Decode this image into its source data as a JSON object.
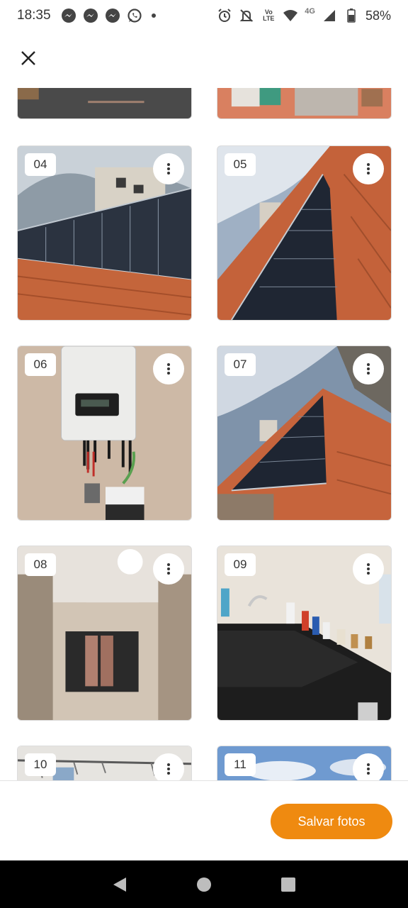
{
  "status_bar": {
    "time": "18:35",
    "notifications": [
      "messenger-icon",
      "messenger-icon",
      "messenger-icon",
      "whatsapp-icon"
    ],
    "volte_label": "Vo\nLTE",
    "network": "4G",
    "battery": "58%"
  },
  "photos": [
    {
      "number": "",
      "scene": "street"
    },
    {
      "number": "",
      "scene": "rooftop-partial"
    },
    {
      "number": "04",
      "scene": "solar-roof-wide"
    },
    {
      "number": "05",
      "scene": "solar-roof-steep"
    },
    {
      "number": "06",
      "scene": "inverter"
    },
    {
      "number": "07",
      "scene": "solar-roof-sky"
    },
    {
      "number": "08",
      "scene": "hallway"
    },
    {
      "number": "09",
      "scene": "bathroom-sink"
    },
    {
      "number": "10",
      "scene": "ceiling"
    },
    {
      "number": "11",
      "scene": "sky"
    }
  ],
  "footer": {
    "save_label": "Salvar fotos"
  },
  "colors": {
    "accent": "#ef8a10"
  }
}
